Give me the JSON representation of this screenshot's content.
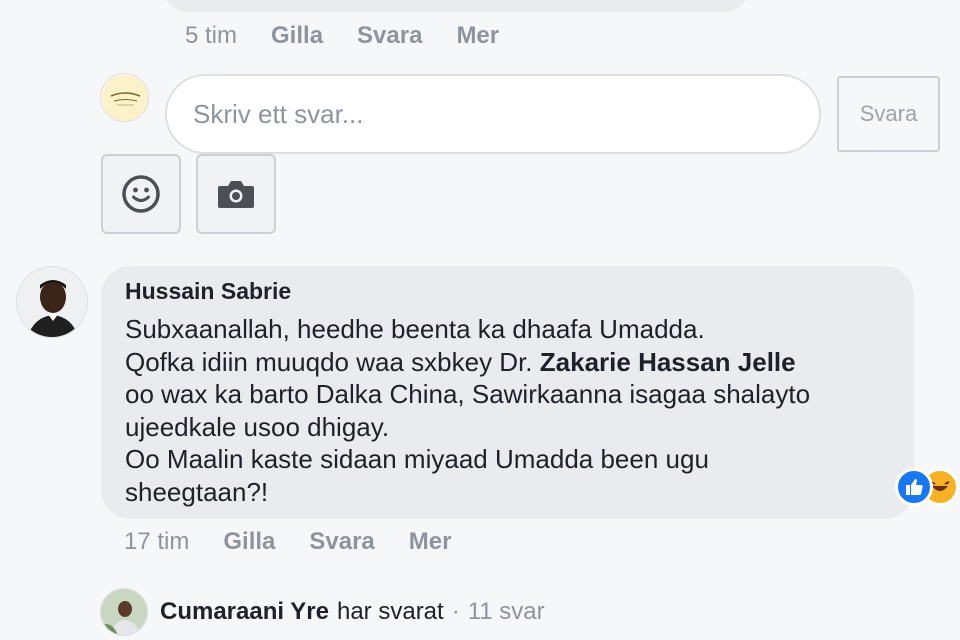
{
  "previous_comment": {
    "time": "5 tim",
    "like_label": "Gilla",
    "reply_label": "Svara",
    "more_label": "Mer"
  },
  "reply_box": {
    "placeholder": "Skriv ett svar...",
    "send_label": "Svara",
    "emoji_icon": "smiley-icon",
    "camera_icon": "camera-icon"
  },
  "comment": {
    "author": "Hussain Sabrie",
    "lines": [
      "Subxaanallah, heedhe beenta ka dhaafa Umadda.",
      "Qofka idiin muuqdo waa sxbkey Dr.",
      "Zakarie Hassan Jelle",
      "oo wax ka barto Dalka China, Sawirkaanna isagaa shalayto",
      "ujeedkale usoo dhigay.",
      "Oo Maalin kaste sidaan miyaad Umadda been ugu",
      "sheegtaan?!"
    ],
    "time": "17 tim",
    "like_label": "Gilla",
    "reply_label": "Svara",
    "more_label": "Mer",
    "reactions": [
      "like-icon",
      "haha-icon"
    ]
  },
  "replies": {
    "name": "Cumaraani Yre",
    "verb": "har svarat",
    "separator": "·",
    "count": "11 svar"
  },
  "colors": {
    "background": "#f6f7f9",
    "bubble": "#e9ebee",
    "muted_text": "#8d949e",
    "like_blue": "#1877f2"
  }
}
